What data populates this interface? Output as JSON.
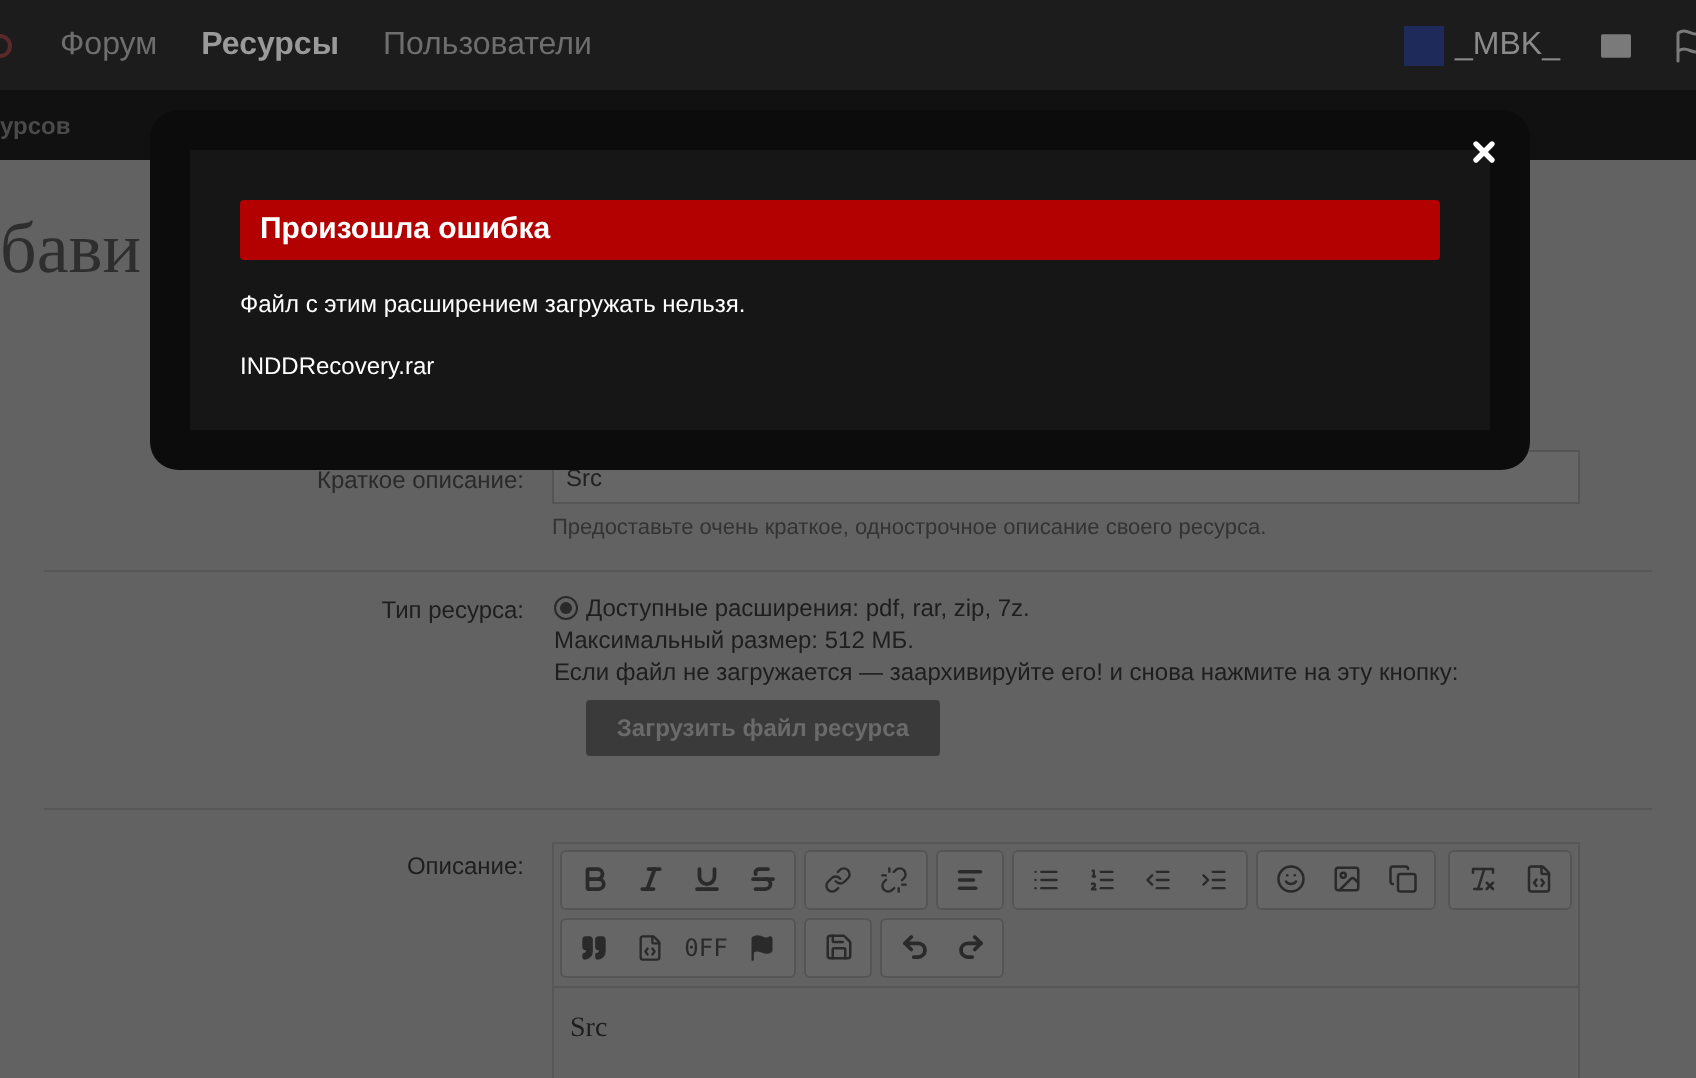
{
  "nav": {
    "items": [
      {
        "label": "Форум",
        "selected": false
      },
      {
        "label": "Ресурсы",
        "selected": true
      },
      {
        "label": "Пользователи",
        "selected": false
      }
    ],
    "user": {
      "name": "_MBK_"
    }
  },
  "submenu": [
    "урсов"
  ],
  "page_title": "бави",
  "fields": [
    {
      "label": "Краткое описание:",
      "value": "Src",
      "hint": "Предоставьте очень краткое, однострочное описание своего ресурса."
    }
  ],
  "resource_type": {
    "label": "Тип ресурса:",
    "option": {
      "label": "Доступные расширения: pdf, rar, zip, 7z.",
      "selected": true
    },
    "lines": [
      "Максимальный размер: 512 МБ.",
      "Если файл не загружается — заархивируйте его! и снова нажмите на эту кнопку:"
    ],
    "button": "Загрузить файл ресурса"
  },
  "editor": {
    "label": "Описание:",
    "toolbar_text": "0FF",
    "content": "Src"
  },
  "modal": {
    "title": "Произошла ошибка",
    "message": "Файл с этим расширением загружать нельзя.",
    "filename": "INDDRecovery.rar"
  }
}
